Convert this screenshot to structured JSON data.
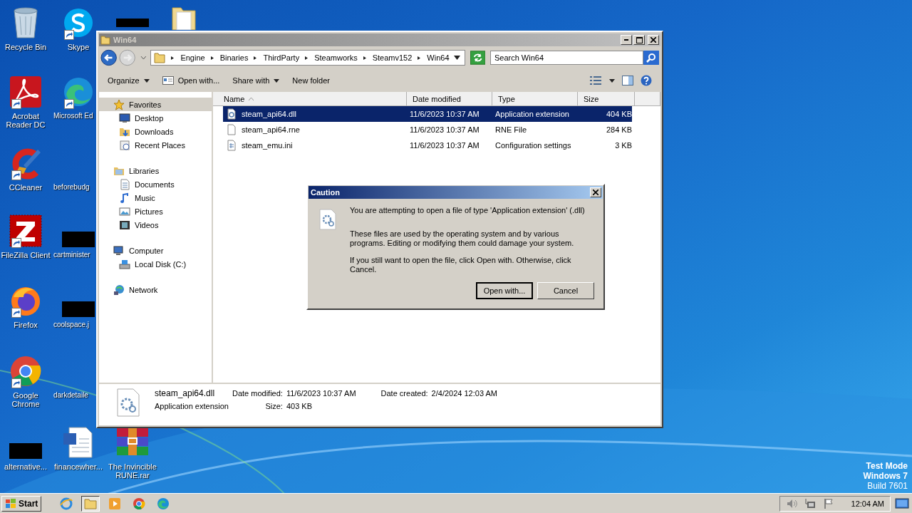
{
  "desktop": {
    "icons": [
      {
        "label": "Recycle Bin",
        "kind": "recycle",
        "shortcut": false
      },
      {
        "label": "Acrobat Reader DC",
        "kind": "acrobat",
        "shortcut": true
      },
      {
        "label": "CCleaner",
        "kind": "ccleaner",
        "shortcut": true
      },
      {
        "label": "FileZilla Client",
        "kind": "filezilla",
        "shortcut": true
      },
      {
        "label": "Firefox",
        "kind": "firefox",
        "shortcut": true
      },
      {
        "label": "Google Chrome",
        "kind": "chrome",
        "shortcut": true
      },
      {
        "label": "alternative...",
        "kind": "redacted",
        "shortcut": false
      },
      {
        "label": "Skype",
        "kind": "skype",
        "shortcut": true
      },
      {
        "label": "Microsoft Ed",
        "kind": "edge",
        "shortcut": true
      },
      {
        "label": "beforebudg",
        "kind": "blank",
        "shortcut": false
      },
      {
        "label": "cartminister",
        "kind": "redacted",
        "shortcut": false
      },
      {
        "label": "coolspace.j",
        "kind": "redacted",
        "shortcut": false
      },
      {
        "label": "darkdetaile",
        "kind": "blank",
        "shortcut": false
      },
      {
        "label": "financewher...",
        "kind": "word",
        "shortcut": false
      },
      {
        "kind": "redacted"
      },
      {
        "label": "The Invincible RUNE.rar",
        "kind": "winrar",
        "shortcut": false
      },
      {
        "kind": "folder"
      }
    ],
    "watermark": [
      "Test Mode",
      "Windows 7",
      "Build 7601"
    ]
  },
  "window": {
    "title": "Win64",
    "breadcrumb": [
      "Engine",
      "Binaries",
      "ThirdParty",
      "Steamworks",
      "Steamv152",
      "Win64"
    ],
    "search": {
      "placeholder": "Search Win64"
    },
    "toolbar": [
      {
        "label": "Organize",
        "dropdown": true
      },
      {
        "label": "Open with...",
        "dropdown": false,
        "icon": true
      },
      {
        "label": "Share with",
        "dropdown": true
      },
      {
        "label": "New folder",
        "dropdown": false
      }
    ],
    "nav": [
      {
        "label": "Favorites",
        "kind": "star",
        "selected": true,
        "children": [
          {
            "label": "Desktop",
            "kind": "desktop",
            "selected": false
          },
          {
            "label": "Downloads",
            "kind": "downloads",
            "selected": false
          },
          {
            "label": "Recent Places",
            "kind": "recent",
            "selected": false
          }
        ]
      },
      {
        "label": "Libraries",
        "kind": "library",
        "selected": false,
        "children": [
          {
            "label": "Documents",
            "kind": "documents",
            "selected": false
          },
          {
            "label": "Music",
            "kind": "music",
            "selected": false
          },
          {
            "label": "Pictures",
            "kind": "pictures",
            "selected": false
          },
          {
            "label": "Videos",
            "kind": "videos",
            "selected": false
          }
        ]
      },
      {
        "label": "Computer",
        "kind": "computer",
        "selected": false,
        "children": [
          {
            "label": "Local Disk (C:)",
            "kind": "disk",
            "selected": false
          }
        ]
      },
      {
        "label": "Network",
        "kind": "network",
        "selected": false
      }
    ],
    "columns": [
      {
        "label": "Name",
        "sorted": true
      },
      {
        "label": "Date modified",
        "sorted": false
      },
      {
        "label": "Type",
        "sorted": false
      },
      {
        "label": "Size",
        "sorted": false
      }
    ],
    "files": [
      {
        "name": "steam_api64.dll",
        "kind": "dll",
        "date": "11/6/2023 10:37 AM",
        "type": "Application extension",
        "size": "404 KB",
        "selected": true
      },
      {
        "name": "steam_api64.rne",
        "kind": "blank",
        "date": "11/6/2023 10:37 AM",
        "type": "RNE File",
        "size": "284 KB",
        "selected": false
      },
      {
        "name": "steam_emu.ini",
        "kind": "ini",
        "date": "11/6/2023 10:37 AM",
        "type": "Configuration settings",
        "size": "3 KB",
        "selected": false
      }
    ],
    "details": {
      "name": "steam_api64.dll",
      "type": "Application extension",
      "modified_label": "Date modified:",
      "modified": "11/6/2023 10:37 AM",
      "size_label": "Size:",
      "size": "403 KB",
      "created_label": "Date created:",
      "created": "2/4/2024 12:03 AM"
    }
  },
  "dialog": {
    "title": "Caution",
    "paragraphs": [
      "You are attempting to open a file of type 'Application extension' (.dll)",
      "These files are used by the operating system and by various programs. Editing or modifying them could damage your system.",
      "If you still want to open the file, click Open with. Otherwise, click Cancel."
    ],
    "buttons": [
      {
        "label": "Open with...",
        "default": true
      },
      {
        "label": "Cancel",
        "default": false
      }
    ]
  },
  "taskbar": {
    "start": "Start",
    "apps": [
      {
        "kind": "ie",
        "active": false
      },
      {
        "kind": "explorer",
        "active": true
      },
      {
        "kind": "media",
        "active": false
      },
      {
        "kind": "chrome",
        "active": false
      },
      {
        "kind": "edge",
        "active": false
      }
    ],
    "time": "12:04 AM"
  }
}
